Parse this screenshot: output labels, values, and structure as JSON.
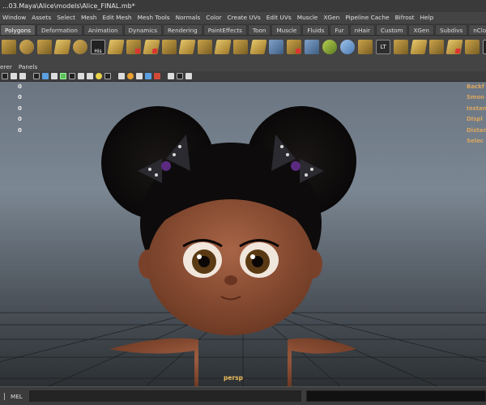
{
  "title": "...03.Maya\\Alice\\models\\Alice_FINAL.mb*",
  "menus": [
    "Window",
    "Assets",
    "Select",
    "Mesh",
    "Edit Mesh",
    "Mesh Tools",
    "Normals",
    "Color",
    "Create UVs",
    "Edit UVs",
    "Muscle",
    "XGen",
    "Pipeline Cache",
    "Bifrost",
    "Help"
  ],
  "shelf_tabs": [
    "Polygons",
    "Deformation",
    "Animation",
    "Dynamics",
    "Rendering",
    "PaintEffects",
    "Toon",
    "Muscle",
    "Fluids",
    "Fur",
    "nHair",
    "Custom",
    "XGen",
    "Subdivs",
    "nCloth"
  ],
  "active_shelf_tab": "Polygons",
  "shelf_icon_labels": {
    "his": "His",
    "lt": "LT",
    "de": "DE"
  },
  "panel_menus": [
    "erer",
    "Panels"
  ],
  "hud": {
    "left_values": [
      "0",
      "0",
      "0",
      "0",
      "0"
    ],
    "right_labels": [
      "Backf",
      "Smoo",
      "Instan",
      "Displ",
      "Distan",
      "Selec"
    ]
  },
  "camera": "persp",
  "command_line": {
    "language": "MEL",
    "input": "",
    "result": ""
  },
  "colors": {
    "active_tab": "#5d5d5d",
    "hud_label": "#d9a660",
    "camera_label": "#f0c060"
  }
}
